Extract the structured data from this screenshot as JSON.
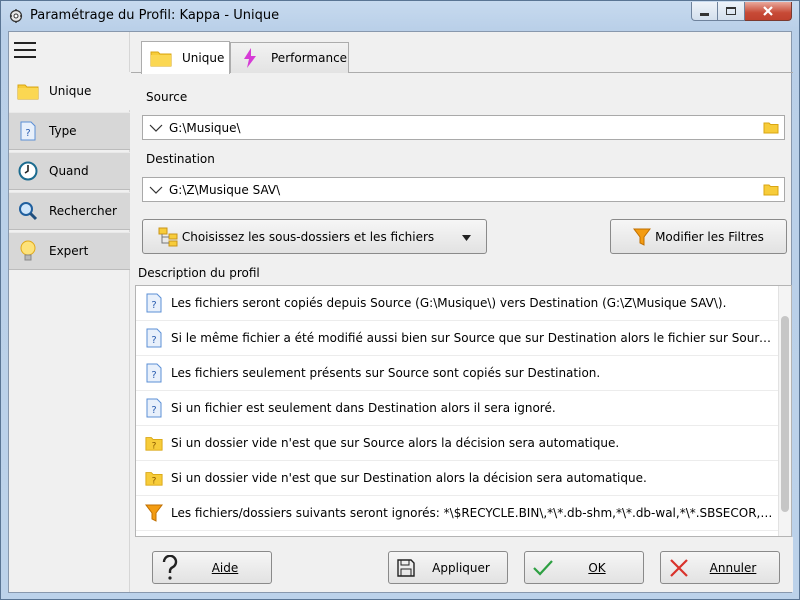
{
  "window": {
    "title": "Paramétrage du Profil: Kappa - Unique",
    "icons": {
      "app": "gear-icon",
      "minimize": "minimize-icon",
      "maximize": "maximize-icon",
      "close": "close-icon"
    }
  },
  "nav": {
    "menu_icon": "hamburger-menu-icon",
    "items": [
      {
        "label": "Unique",
        "icon": "folder-icon",
        "active": true
      },
      {
        "label": "Type",
        "icon": "question-file-icon",
        "active": false
      },
      {
        "label": "Quand",
        "icon": "clock-icon",
        "active": false
      },
      {
        "label": "Rechercher",
        "icon": "magnifier-icon",
        "active": false
      },
      {
        "label": "Expert",
        "icon": "lightbulb-icon",
        "active": false
      }
    ]
  },
  "tabs": [
    {
      "label": "Unique",
      "icon": "folder-icon",
      "active": true
    },
    {
      "label": "Performance",
      "icon": "lightning-icon",
      "active": false
    }
  ],
  "source": {
    "label": "Source",
    "value": "G:\\Musique\\"
  },
  "destination": {
    "label": "Destination",
    "value": "G:\\Z\\Musique SAV\\"
  },
  "subfolders_button": {
    "label": "Choisissez les sous-dossiers et les fichiers"
  },
  "filters_button": {
    "label": "Modifier les Filtres"
  },
  "description": {
    "label": "Description du profil",
    "rows": [
      {
        "icon": "question-file-icon",
        "text": "Les fichiers seront copiés depuis Source (G:\\Musique\\) vers Destination (G:\\Z\\Musique SAV\\)."
      },
      {
        "icon": "question-file-icon",
        "text": "Si le même fichier a été modifié aussi bien sur Source que sur Destination alors le fichier sur Source remplacera le ..."
      },
      {
        "icon": "question-file-icon",
        "text": "Les fichiers seulement présents sur Source sont copiés sur Destination."
      },
      {
        "icon": "question-file-icon",
        "text": "Si un fichier est seulement dans Destination alors il sera ignoré."
      },
      {
        "icon": "question-folder-icon",
        "text": "Si un dossier vide n'est que sur Source alors la décision sera automatique."
      },
      {
        "icon": "question-folder-icon",
        "text": "Si un dossier vide n'est que sur Destination alors la décision sera automatique."
      },
      {
        "icon": "filter-icon",
        "text": "Les fichiers/dossiers suivants seront ignorés: *\\$RECYCLE.BIN\\,*\\*.db-shm,*\\*.db-wal,*\\*.SBSECOR,\"*\\AppData\\L..."
      }
    ]
  },
  "footer": {
    "help": "Aide",
    "apply": "Appliquer",
    "ok": "OK",
    "cancel": "Annuler"
  },
  "colors": {
    "folder_yellow": "#f5c518",
    "question_blue": "#5b8fd6",
    "filter_orange": "#f39c12",
    "ok_green": "#2ea043",
    "cancel_red": "#d9322b",
    "lightning_magenta": "#d63bd6"
  }
}
